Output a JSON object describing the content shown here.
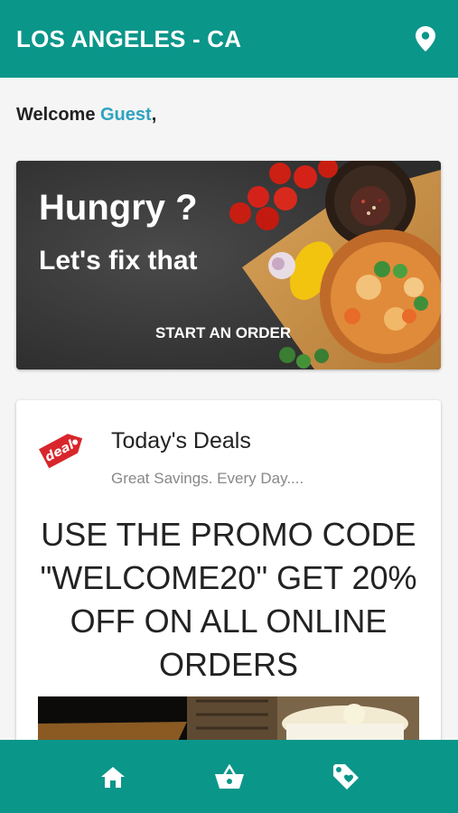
{
  "header": {
    "location": "LOS ANGELES - CA",
    "location_icon": "map-pin-icon"
  },
  "welcome": {
    "prefix": "Welcome ",
    "name": "Guest",
    "suffix": ","
  },
  "hero": {
    "headline": "Hungry ?",
    "subheadline": "Let's fix that",
    "cta_label": "START AN ORDER"
  },
  "deals": {
    "icon": "deal-tag-icon",
    "icon_text": "deal",
    "title": "Today's Deals",
    "subtitle": "Great Savings. Every Day....",
    "promo": "USE THE PROMO CODE \"WELCOME20\" GET 20% OFF ON ALL ONLINE ORDERS"
  },
  "bottom_nav": [
    {
      "icon": "home-icon"
    },
    {
      "icon": "basket-icon"
    },
    {
      "icon": "tag-icon"
    }
  ],
  "colors": {
    "primary": "#0b968a",
    "accent": "#2ea3c0",
    "deal_red": "#d8262c"
  }
}
